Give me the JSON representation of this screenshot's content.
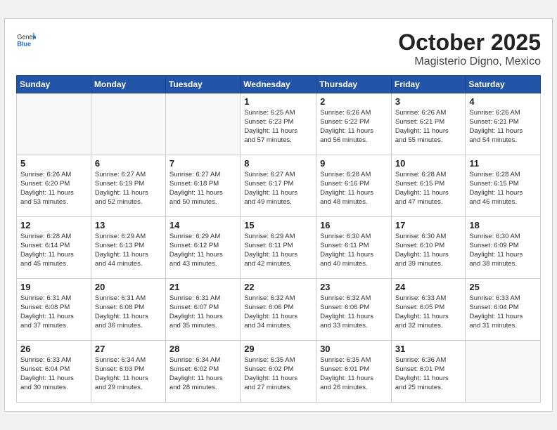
{
  "header": {
    "logo_general": "General",
    "logo_blue": "Blue",
    "month_title": "October 2025",
    "location": "Magisterio Digno, Mexico"
  },
  "days_of_week": [
    "Sunday",
    "Monday",
    "Tuesday",
    "Wednesday",
    "Thursday",
    "Friday",
    "Saturday"
  ],
  "weeks": [
    [
      {
        "day": "",
        "info": ""
      },
      {
        "day": "",
        "info": ""
      },
      {
        "day": "",
        "info": ""
      },
      {
        "day": "1",
        "info": "Sunrise: 6:25 AM\nSunset: 6:23 PM\nDaylight: 11 hours\nand 57 minutes."
      },
      {
        "day": "2",
        "info": "Sunrise: 6:26 AM\nSunset: 6:22 PM\nDaylight: 11 hours\nand 56 minutes."
      },
      {
        "day": "3",
        "info": "Sunrise: 6:26 AM\nSunset: 6:21 PM\nDaylight: 11 hours\nand 55 minutes."
      },
      {
        "day": "4",
        "info": "Sunrise: 6:26 AM\nSunset: 6:21 PM\nDaylight: 11 hours\nand 54 minutes."
      }
    ],
    [
      {
        "day": "5",
        "info": "Sunrise: 6:26 AM\nSunset: 6:20 PM\nDaylight: 11 hours\nand 53 minutes."
      },
      {
        "day": "6",
        "info": "Sunrise: 6:27 AM\nSunset: 6:19 PM\nDaylight: 11 hours\nand 52 minutes."
      },
      {
        "day": "7",
        "info": "Sunrise: 6:27 AM\nSunset: 6:18 PM\nDaylight: 11 hours\nand 50 minutes."
      },
      {
        "day": "8",
        "info": "Sunrise: 6:27 AM\nSunset: 6:17 PM\nDaylight: 11 hours\nand 49 minutes."
      },
      {
        "day": "9",
        "info": "Sunrise: 6:28 AM\nSunset: 6:16 PM\nDaylight: 11 hours\nand 48 minutes."
      },
      {
        "day": "10",
        "info": "Sunrise: 6:28 AM\nSunset: 6:15 PM\nDaylight: 11 hours\nand 47 minutes."
      },
      {
        "day": "11",
        "info": "Sunrise: 6:28 AM\nSunset: 6:15 PM\nDaylight: 11 hours\nand 46 minutes."
      }
    ],
    [
      {
        "day": "12",
        "info": "Sunrise: 6:28 AM\nSunset: 6:14 PM\nDaylight: 11 hours\nand 45 minutes."
      },
      {
        "day": "13",
        "info": "Sunrise: 6:29 AM\nSunset: 6:13 PM\nDaylight: 11 hours\nand 44 minutes."
      },
      {
        "day": "14",
        "info": "Sunrise: 6:29 AM\nSunset: 6:12 PM\nDaylight: 11 hours\nand 43 minutes."
      },
      {
        "day": "15",
        "info": "Sunrise: 6:29 AM\nSunset: 6:11 PM\nDaylight: 11 hours\nand 42 minutes."
      },
      {
        "day": "16",
        "info": "Sunrise: 6:30 AM\nSunset: 6:11 PM\nDaylight: 11 hours\nand 40 minutes."
      },
      {
        "day": "17",
        "info": "Sunrise: 6:30 AM\nSunset: 6:10 PM\nDaylight: 11 hours\nand 39 minutes."
      },
      {
        "day": "18",
        "info": "Sunrise: 6:30 AM\nSunset: 6:09 PM\nDaylight: 11 hours\nand 38 minutes."
      }
    ],
    [
      {
        "day": "19",
        "info": "Sunrise: 6:31 AM\nSunset: 6:08 PM\nDaylight: 11 hours\nand 37 minutes."
      },
      {
        "day": "20",
        "info": "Sunrise: 6:31 AM\nSunset: 6:08 PM\nDaylight: 11 hours\nand 36 minutes."
      },
      {
        "day": "21",
        "info": "Sunrise: 6:31 AM\nSunset: 6:07 PM\nDaylight: 11 hours\nand 35 minutes."
      },
      {
        "day": "22",
        "info": "Sunrise: 6:32 AM\nSunset: 6:06 PM\nDaylight: 11 hours\nand 34 minutes."
      },
      {
        "day": "23",
        "info": "Sunrise: 6:32 AM\nSunset: 6:06 PM\nDaylight: 11 hours\nand 33 minutes."
      },
      {
        "day": "24",
        "info": "Sunrise: 6:33 AM\nSunset: 6:05 PM\nDaylight: 11 hours\nand 32 minutes."
      },
      {
        "day": "25",
        "info": "Sunrise: 6:33 AM\nSunset: 6:04 PM\nDaylight: 11 hours\nand 31 minutes."
      }
    ],
    [
      {
        "day": "26",
        "info": "Sunrise: 6:33 AM\nSunset: 6:04 PM\nDaylight: 11 hours\nand 30 minutes."
      },
      {
        "day": "27",
        "info": "Sunrise: 6:34 AM\nSunset: 6:03 PM\nDaylight: 11 hours\nand 29 minutes."
      },
      {
        "day": "28",
        "info": "Sunrise: 6:34 AM\nSunset: 6:02 PM\nDaylight: 11 hours\nand 28 minutes."
      },
      {
        "day": "29",
        "info": "Sunrise: 6:35 AM\nSunset: 6:02 PM\nDaylight: 11 hours\nand 27 minutes."
      },
      {
        "day": "30",
        "info": "Sunrise: 6:35 AM\nSunset: 6:01 PM\nDaylight: 11 hours\nand 26 minutes."
      },
      {
        "day": "31",
        "info": "Sunrise: 6:36 AM\nSunset: 6:01 PM\nDaylight: 11 hours\nand 25 minutes."
      },
      {
        "day": "",
        "info": ""
      }
    ]
  ]
}
